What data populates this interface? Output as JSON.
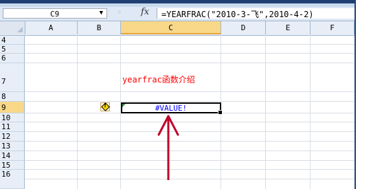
{
  "name_box": {
    "value": "C9"
  },
  "formula_bar": {
    "fx_label": "fx",
    "formula": "=YEARFRAC(\"2010-3-飞\",2010-4-2)"
  },
  "columns": [
    "A",
    "B",
    "C",
    "D",
    "E",
    "F"
  ],
  "selected_column": "C",
  "rows": [
    "4",
    "5",
    "6",
    "7",
    "8",
    "9",
    "10",
    "11",
    "12",
    "13",
    "14",
    "15",
    "16"
  ],
  "selected_row": "9",
  "cells": {
    "C7": "yearfrac函数介绍",
    "C9": "#VALUE!"
  },
  "colors": {
    "selection_header": "#f8d888",
    "annotation_text": "#ff0000",
    "error_text": "#0000ff",
    "arrow": "#c0002a"
  },
  "icons": {
    "error_indicator": "warning-diamond-icon",
    "annotation_arrow": "up-arrow-icon"
  }
}
